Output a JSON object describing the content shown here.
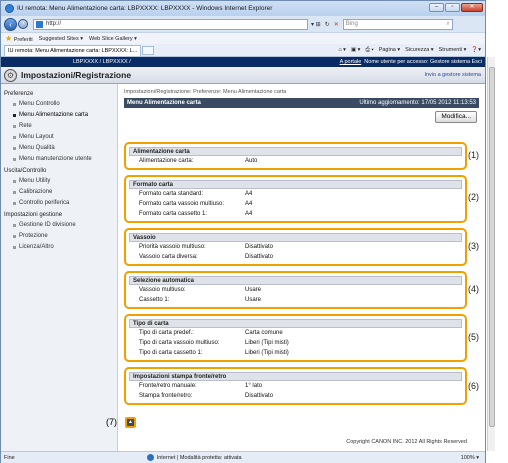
{
  "browser": {
    "window_title": "IU remota: Menu Alimentazione carta: LBPXXXX: LBPXXXX - Windows Internet Explorer",
    "address": "http://",
    "search_placeholder": "Bing",
    "favorites_label": "Preferiti",
    "fav_items": [
      "Suggested Sites ▾",
      "Web Slice Gallery ▾"
    ],
    "tab_title": "IU remota: Menu Alimentazione carta: LBPXXXX: L...",
    "commands": [
      "Pagina ▾",
      "Sicurezza ▾",
      "Strumenti ▾"
    ],
    "status_left": "Fine",
    "status_zone": "Internet | Modalità protetta: attivata",
    "status_zoom": "100% ▾"
  },
  "topbar": {
    "device": "LBPXXXX / LBPXXXX /",
    "link1": "A portale",
    "link2": "Nome utente per accesso: Gestore sistema Esci"
  },
  "header": {
    "title": "Impostazioni/Registrazione",
    "link": "Invio a gestore sistema"
  },
  "sidebar": {
    "group1": "Preferenze",
    "group1_items": [
      "Menu Controllo",
      "Menu Alimentazione carta",
      "Rete",
      "Menu Layout",
      "Menu Qualità",
      "Menu manutenzione utente"
    ],
    "group2": "Uscita/Controllo",
    "group2_items": [
      "Menu Utility",
      "Calibrazione",
      "Controllo periferica"
    ],
    "group3": "Impostazioni gestione",
    "group3_items": [
      "Gestione ID divisione",
      "Protezione",
      "Licenza/Altro"
    ]
  },
  "main": {
    "breadcrumb": "Impostazioni/Registrazione: Preferenze: Menu Alimentazione carta",
    "title": "Menu Alimentazione carta",
    "updated": "Ultimo aggiornamento: 17/05 2012 11:13:53",
    "modify_button": "Modifica..."
  },
  "sections": [
    {
      "title": "Alimentazione carta",
      "callout": "(1)",
      "rows": [
        [
          "Alimentazione carta:",
          "Auto"
        ]
      ]
    },
    {
      "title": "Formato carta",
      "callout": "(2)",
      "rows": [
        [
          "Formato carta standard:",
          "A4"
        ],
        [
          "Formato carta vassoio multiuso:",
          "A4"
        ],
        [
          "Formato carta cassetto 1:",
          "A4"
        ]
      ]
    },
    {
      "title": "Vassoio",
      "callout": "(3)",
      "rows": [
        [
          "Priorità vassoio multiuso:",
          "Disattivato"
        ],
        [
          "Vassoio carta diversa:",
          "Disattivato"
        ]
      ]
    },
    {
      "title": "Selezione automatica",
      "callout": "(4)",
      "rows": [
        [
          "Vassoio multiuso:",
          "Usare"
        ],
        [
          "Cassetto 1:",
          "Usare"
        ]
      ]
    },
    {
      "title": "Tipo di carta",
      "callout": "(5)",
      "rows": [
        [
          "Tipo di carta predef.:",
          "Carta comune"
        ],
        [
          "Tipo di carta vassoio multiuso:",
          "Liberi (Tipi misti)"
        ],
        [
          "Tipo di carta cassetto 1:",
          "Liberi (Tipi misti)"
        ]
      ]
    },
    {
      "title": "Impostazioni stampa fronte/retro",
      "callout": "(6)",
      "rows": [
        [
          "Fronte/retro manuale:",
          "1° lato"
        ],
        [
          "Stampa fronte/retro:",
          "Disattivato"
        ]
      ]
    }
  ],
  "footer": {
    "top_callout": "(7)",
    "copyright": "Copyright CANON INC. 2012 All Rights Reserved"
  }
}
